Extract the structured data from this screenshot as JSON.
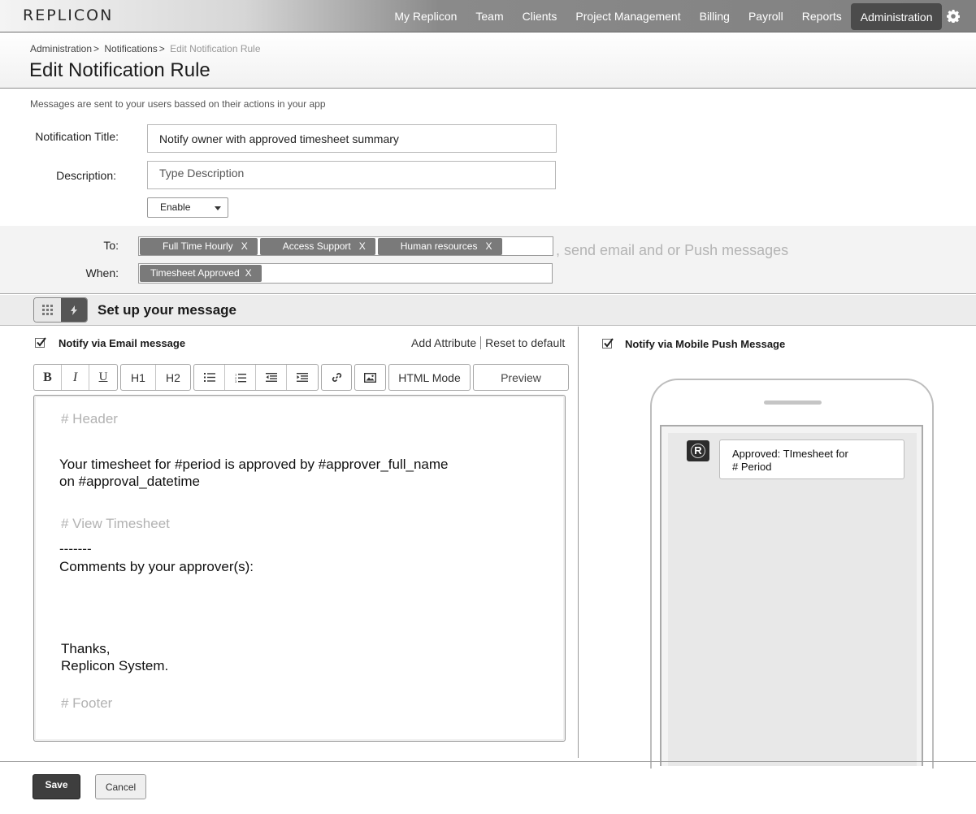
{
  "app": {
    "logo": "REPLICON"
  },
  "nav": {
    "items": [
      "My Replicon",
      "Team",
      "Clients",
      "Project Management",
      "Billing",
      "Payroll",
      "Reports",
      "Administration"
    ],
    "active": "Administration"
  },
  "breadcrumb": {
    "items": [
      "Administration",
      "Notifications"
    ],
    "current": "Edit Notification Rule",
    "separator": ">"
  },
  "page": {
    "title": "Edit Notification Rule",
    "intro": "Messages are sent to your users bassed on their actions in your app"
  },
  "form": {
    "title_label": "Notification Title:",
    "title_value": "Notify owner with approved timesheet summary",
    "description_label": "Description:",
    "description_placeholder": "Type Description",
    "status_value": "Enable"
  },
  "recipients": {
    "to_label": "To:",
    "to_tags": [
      "Full Time Hourly",
      "Access Support",
      "Human resources"
    ],
    "when_label": "When:",
    "when_tags": [
      "Timesheet Approved"
    ],
    "tag_remove": "X",
    "hint": ", send email and or Push messages"
  },
  "message": {
    "section_title": "Set up your message",
    "email_label": "Notify via Email message",
    "add_attribute": "Add Attribute",
    "reset_default": "Reset to default",
    "toolbar": {
      "bold": "B",
      "italic": "I",
      "underline": "U",
      "h1": "H1",
      "h2": "H2",
      "html_mode": "HTML Mode",
      "preview": "Preview"
    },
    "editor": {
      "header_ph": "# Header",
      "line1": "Your timesheet for #period is approved by #approver_full_name",
      "line2": "on #approval_datetime",
      "view_ph": "# View Timesheet",
      "dashes": "-------",
      "comments": "Comments by your approver(s):",
      "thanks": "Thanks,",
      "signature": "Replicon System.",
      "footer_ph": "# Footer"
    },
    "push_label": "Notify via Mobile Push Message",
    "push_preview": {
      "app_letter": "R",
      "line1": "Approved: TImesheet for",
      "line2": "# Period"
    }
  },
  "actions": {
    "save": "Save",
    "cancel": "Cancel"
  },
  "colors": {
    "nav_active": "#4b4b4b",
    "tag_bg": "#7a7a7a",
    "save_bg": "#3e3e3e"
  }
}
